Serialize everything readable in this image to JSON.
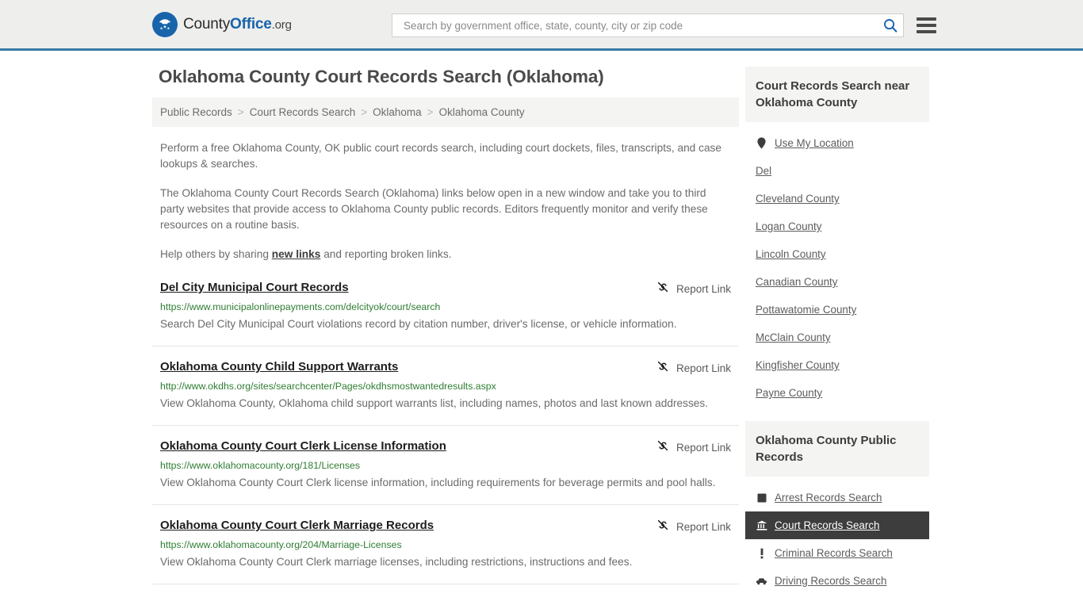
{
  "header": {
    "logo": {
      "part1": "County",
      "part2": "Office",
      "part3": ".org"
    },
    "search": {
      "placeholder": "Search by government office, state, county, city or zip code",
      "value": ""
    }
  },
  "main": {
    "title": "Oklahoma County Court Records Search (Oklahoma)",
    "breadcrumb": [
      "Public Records",
      "Court Records Search",
      "Oklahoma",
      "Oklahoma County"
    ],
    "intro": [
      "Perform a free Oklahoma County, OK public court records search, including court dockets, files, transcripts, and case lookups & searches.",
      "The Oklahoma County Court Records Search (Oklahoma) links below open in a new window and take you to third party websites that provide access to Oklahoma County public records. Editors frequently monitor and verify these resources on a routine basis."
    ],
    "help_prefix": "Help others by sharing ",
    "help_link": "new links",
    "help_suffix": " and reporting broken links.",
    "report_label": "Report Link",
    "results": [
      {
        "title": "Del City Municipal Court Records",
        "url": "https://www.municipalonlinepayments.com/delcityok/court/search",
        "description": "Search Del City Municipal Court violations record by citation number, driver's license, or vehicle information."
      },
      {
        "title": "Oklahoma County Child Support Warrants",
        "url": "http://www.okdhs.org/sites/searchcenter/Pages/okdhsmostwantedresults.aspx",
        "description": "View Oklahoma County, Oklahoma child support warrants list, including names, photos and last known addresses."
      },
      {
        "title": "Oklahoma County Court Clerk License Information",
        "url": "https://www.oklahomacounty.org/181/Licenses",
        "description": "View Oklahoma County Court Clerk license information, including requirements for beverage permits and pool halls."
      },
      {
        "title": "Oklahoma County Court Clerk Marriage Records",
        "url": "https://www.oklahomacounty.org/204/Marriage-Licenses",
        "description": "View Oklahoma County Court Clerk marriage licenses, including restrictions, instructions and fees."
      }
    ]
  },
  "sidebar": {
    "nearby": {
      "heading": "Court Records Search near Oklahoma County",
      "items": [
        {
          "label": "Use My Location",
          "icon": "map-pin-icon"
        },
        {
          "label": "Del",
          "icon": ""
        },
        {
          "label": "Cleveland County",
          "icon": ""
        },
        {
          "label": "Logan County",
          "icon": ""
        },
        {
          "label": "Lincoln County",
          "icon": ""
        },
        {
          "label": "Canadian County",
          "icon": ""
        },
        {
          "label": "Pottawatomie County",
          "icon": ""
        },
        {
          "label": "McClain County",
          "icon": ""
        },
        {
          "label": "Kingfisher County",
          "icon": ""
        },
        {
          "label": "Payne County",
          "icon": ""
        }
      ]
    },
    "public_records": {
      "heading": "Oklahoma County Public Records",
      "items": [
        {
          "label": "Arrest Records Search",
          "icon": "square-icon",
          "active": false
        },
        {
          "label": "Court Records Search",
          "icon": "courthouse-icon",
          "active": true
        },
        {
          "label": "Criminal Records Search",
          "icon": "exclamation-icon",
          "active": false
        },
        {
          "label": "Driving Records Search",
          "icon": "car-icon",
          "active": false
        }
      ]
    }
  },
  "colors": {
    "brand_blue": "#1864ab",
    "header_border": "#3a7ca8",
    "url_green": "#2e7d32",
    "active_bg": "#3d3d3d"
  }
}
